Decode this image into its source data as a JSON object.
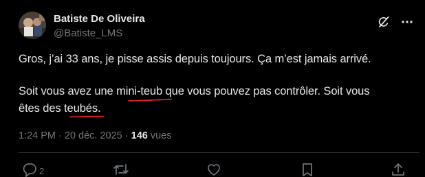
{
  "author": {
    "name": "Batiste De Oliveira",
    "handle": "@Batiste_LMS"
  },
  "post": {
    "line1": "Gros, j’ai 33 ans, je pisse assis depuis toujours. Ça m’est jamais arrivé.",
    "line2": "Soit vous avez une mini-teub que vous pouvez pas contrôler. Soit vous",
    "line3": "êtes des teubés."
  },
  "meta": {
    "time": "1:24 PM",
    "separator": " · ",
    "date": "20 déc. 2025",
    "views_count": "146",
    "views_label": " vues"
  },
  "actions": {
    "reply_count": "2"
  },
  "colors": {
    "background": "#000000",
    "text": "#e7e9ea",
    "secondary": "#71767b",
    "annotation": "#e0212b"
  },
  "icons": [
    "avatar-photo",
    "grok-icon",
    "more-icon",
    "reply-icon",
    "retweet-icon",
    "like-icon",
    "bookmark-icon",
    "share-icon"
  ]
}
